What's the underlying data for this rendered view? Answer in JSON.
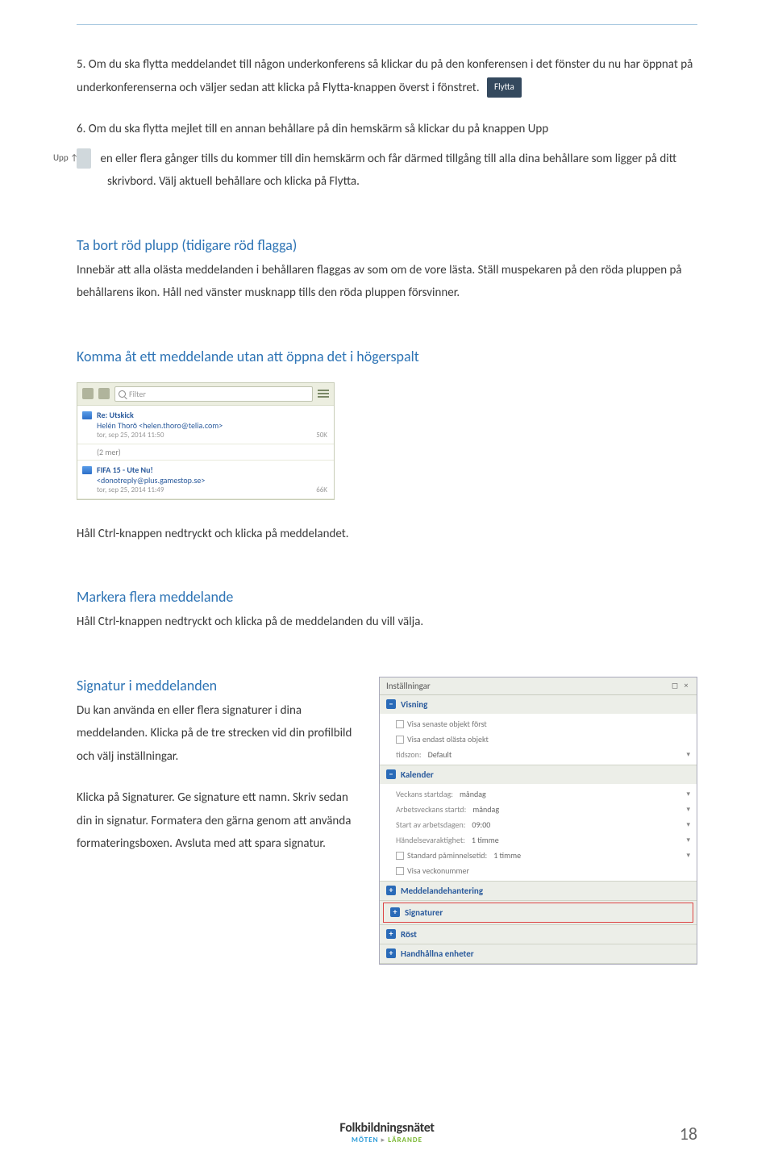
{
  "p5": "5. Om du ska flytta meddelandet till någon underkonferens så klickar du på den konferensen i det fönster du nu har öppnat på underkonferenserna och väljer sedan att klicka på Flytta-knappen överst i fönstret.",
  "btn_flytta": "Flytta",
  "p6a": "6. Om du ska flytta mejlet till en annan behållare på din hemskärm så klickar du på knappen Upp",
  "btn_upp": "Upp ↑",
  "p6b": "en eller flera gånger tills du kommer till din hemskärm och får därmed tillgång till alla dina behållare som ligger på ditt skrivbord. Välj aktuell behållare och klicka på Flytta.",
  "sec1_title": "Ta bort röd plupp (tidigare röd flagga)",
  "sec1_body": "Innebär att alla olästa meddelanden i behållaren flaggas av som om de vore lästa. Ställ muspekaren på den röda pluppen på behållarens ikon. Håll ned vänster musknapp tills den röda pluppen försvinner.",
  "sec2_title": "Komma åt ett meddelande utan att öppna det i högerspalt",
  "msg": {
    "filter": "Filter",
    "item1_subject": "Re: Utskick",
    "item1_from": "Helén Thorö <helen.thoro@telia.com>",
    "item1_date": "tor, sep 25, 2014 11:50",
    "item1_size": "50K",
    "more": "(2 mer)",
    "item2_subject": "FIFA 15 - Ute Nu!",
    "item2_from": "<donotreply@plus.gamestop.se>",
    "item2_date": "tor, sep 25, 2014 11:49",
    "item2_size": "66K"
  },
  "sec2_foot": "Håll Ctrl-knappen nedtryckt och klicka på meddelandet.",
  "sec3_title": "Markera flera meddelande",
  "sec3_body": "Håll Ctrl-knappen nedtryckt och klicka på de meddelanden du vill välja.",
  "sec4_title": "Signatur i meddelanden",
  "sec4_p1": "Du kan använda en eller flera signaturer i dina meddelanden. Klicka på de tre strecken vid din profilbild och välj inställningar.",
  "sec4_p2": "Klicka på Signaturer. Ge signature ett namn. Skriv sedan din in signatur. Formatera den gärna genom att använda formateringsboxen. Avsluta med att spara signatur.",
  "settings": {
    "title": "Inställningar",
    "visning": "Visning",
    "v1": "Visa senaste objekt först",
    "v2": "Visa endast olästa objekt",
    "tidszon_label": "tidszon:",
    "tidszon_val": "Default",
    "kalender": "Kalender",
    "k1_label": "Veckans startdag:",
    "k1_val": "måndag",
    "k2_label": "Arbetsveckans startd:",
    "k2_val": "måndag",
    "k3_label": "Start av arbetsdagen:",
    "k3_val": "09:00",
    "k4_label": "Händelsevaraktighet:",
    "k4_val": "1 timme",
    "k5_label": "Standard påminnelsetid:",
    "k5_val": "1 timme",
    "k6": "Visa veckonummer",
    "medd": "Meddelandehantering",
    "sign": "Signaturer",
    "rost": "Röst",
    "hand": "Handhållna enheter"
  },
  "brand_main": "Folkbildningsnätet",
  "brand_sub1": "MÖTEN",
  "brand_sub2": "LÄRANDE",
  "page": "18"
}
